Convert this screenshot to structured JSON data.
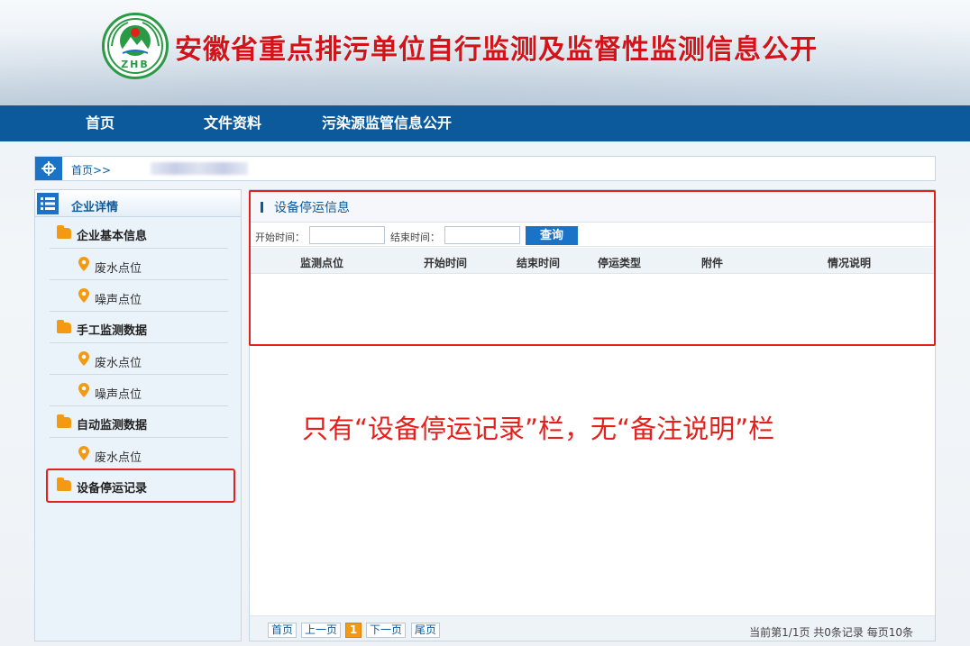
{
  "header": {
    "title": "安徽省重点排污单位自行监测及监督性监测信息公开",
    "logo_text": "ZHB",
    "logo_icon": "zhb-mountain-emblem"
  },
  "nav": {
    "items": [
      {
        "label": "首页"
      },
      {
        "label": "文件资料"
      },
      {
        "label": "污染源监管信息公开"
      }
    ]
  },
  "breadcrumb": {
    "icon": "crosshair-icon",
    "home_label": "首页>>"
  },
  "sidebar": {
    "title": "企业详情",
    "groups": [
      {
        "label": "企业基本信息",
        "children": [
          {
            "label": "废水点位"
          },
          {
            "label": "噪声点位"
          }
        ]
      },
      {
        "label": "手工监测数据",
        "children": [
          {
            "label": "废水点位"
          },
          {
            "label": "噪声点位"
          }
        ]
      },
      {
        "label": "自动监测数据",
        "children": [
          {
            "label": "废水点位"
          }
        ]
      },
      {
        "label": "设备停运记录",
        "children": []
      }
    ]
  },
  "main": {
    "title": "设备停运信息",
    "filters": {
      "start_label": "开始时间：",
      "start_value": "",
      "end_label": "结束时间：",
      "end_value": "",
      "query_label": "查询"
    },
    "columns": [
      "监测点位",
      "开始时间",
      "结束时间",
      "停运类型",
      "附件",
      "情况说明"
    ],
    "rows": [],
    "annotation": "只有“设备停运记录”栏，无“备注说明”栏",
    "pager": {
      "first": "首页",
      "prev": "上一页",
      "current": "1",
      "next": "下一页",
      "last": "尾页",
      "info": "当前第1/1页 共0条记录 每页10条"
    }
  },
  "colors": {
    "nav_bg": "#0c5a9c",
    "title_red": "#d3131a",
    "highlight_red": "#e3201b",
    "folder_orange": "#f39a12",
    "accent_blue": "#1a73c6"
  }
}
